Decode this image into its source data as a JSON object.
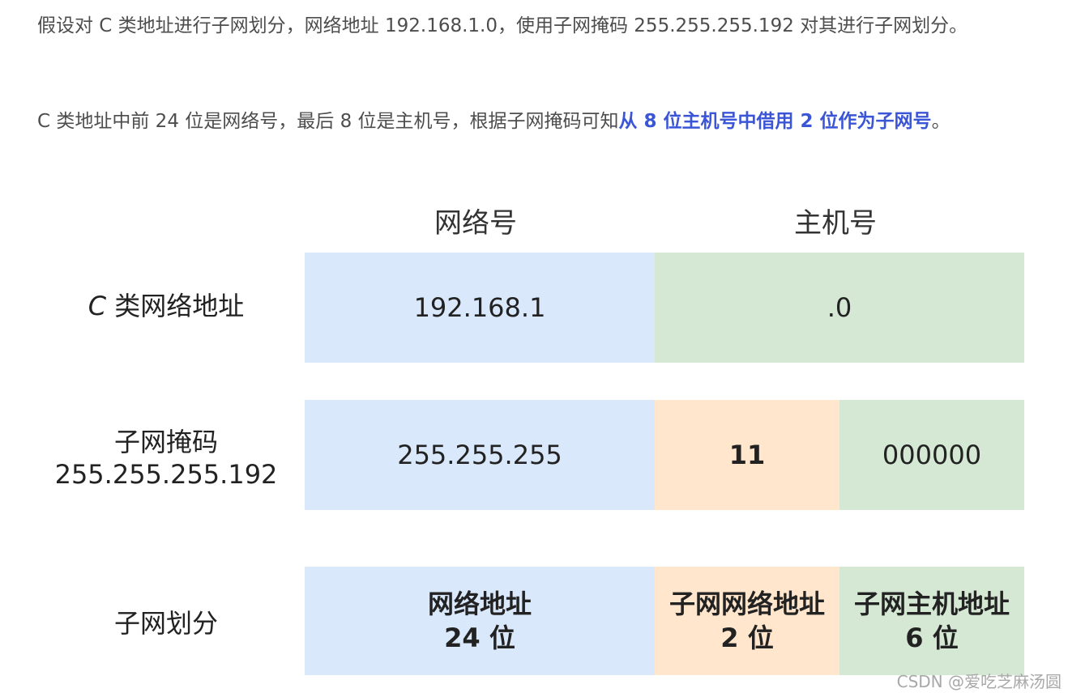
{
  "paragraph1": {
    "text": "假设对 C 类地址进行子网划分，网络地址 192.168.1.0，使用子网掩码 255.255.255.192 对其进行子网划分。"
  },
  "paragraph2": {
    "text_before": "C 类地址中前 24 位是网络号，最后 8 位是主机号，根据子网掩码可知",
    "highlight": "从 8 位主机号中借用 2 位作为子网号",
    "text_after": "。"
  },
  "figure": {
    "headers": {
      "network": "网络号",
      "host": "主机号"
    },
    "rows": [
      {
        "label_c": "C",
        "label_rest": " 类网络地址",
        "network_value": "192.168.1",
        "host_value": ".0"
      },
      {
        "label_line1": "子网掩码",
        "label_line2": "255.255.255.192",
        "network_value": "255.255.255",
        "subnet_bits": "11",
        "host_bits": "000000"
      },
      {
        "label": "子网划分",
        "network_line1": "网络地址",
        "network_line2": "24 位",
        "subnet_line1": "子网网络地址",
        "subnet_line2": "2 位",
        "host_line1": "子网主机地址",
        "host_line2": "6 位"
      }
    ],
    "colors": {
      "network": "#dae8fc",
      "subnet": "#ffe6cc",
      "host": "#d5e8d4"
    }
  },
  "watermark": "CSDN @爱吃芝麻汤圆"
}
